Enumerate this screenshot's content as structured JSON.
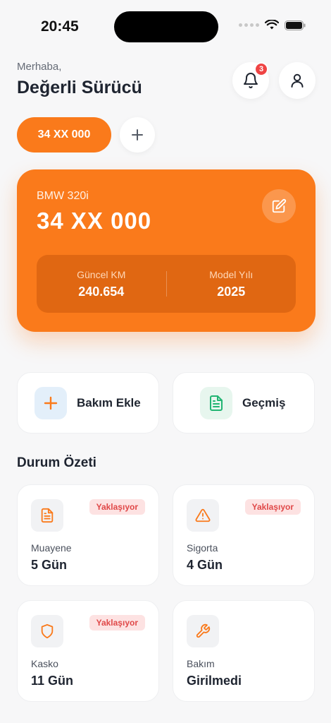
{
  "status_bar": {
    "time": "20:45"
  },
  "header": {
    "greeting": "Merhaba,",
    "name": "Değerli Sürücü",
    "notification_count": "3"
  },
  "vehicle_selector": {
    "selected_plate": "34 XX 000"
  },
  "vehicle_card": {
    "model": "BMW 320i",
    "plate": "34 XX 000",
    "stats": [
      {
        "label": "Güncel KM",
        "value": "240.654"
      },
      {
        "label": "Model Yılı",
        "value": "2025"
      }
    ]
  },
  "actions": [
    {
      "label": "Bakım Ekle",
      "icon": "plus-icon"
    },
    {
      "label": "Geçmiş",
      "icon": "document-icon"
    }
  ],
  "summary": {
    "title": "Durum Özeti",
    "cards": [
      {
        "label": "Muayene",
        "value": "5 Gün",
        "badge": "Yaklaşıyor",
        "icon": "document-icon"
      },
      {
        "label": "Sigorta",
        "value": "4 Gün",
        "badge": "Yaklaşıyor",
        "icon": "warning-icon"
      },
      {
        "label": "Kasko",
        "value": "11 Gün",
        "badge": "Yaklaşıyor",
        "icon": "shield-icon"
      },
      {
        "label": "Bakım",
        "value": "Girilmedi",
        "badge": "",
        "icon": "wrench-icon"
      }
    ]
  },
  "colors": {
    "accent": "#fa7a1b",
    "accent_dark": "#e06712",
    "badge_bg": "#fde2e2",
    "badge_text": "#e04848",
    "success": "#22b573",
    "info_bg": "#e3effa"
  }
}
